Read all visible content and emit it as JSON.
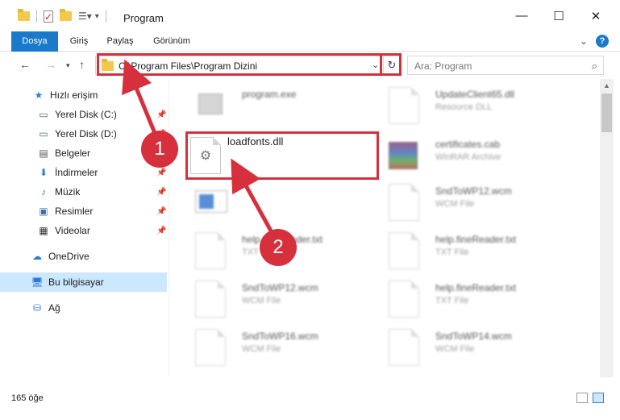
{
  "window": {
    "title": "Program"
  },
  "ribbon": {
    "tabs": [
      "Dosya",
      "Giriş",
      "Paylaş",
      "Görünüm"
    ]
  },
  "address": {
    "path": "C:\\Program Files\\Program Dizini"
  },
  "search": {
    "placeholder": "Ara: Program"
  },
  "sidebar": {
    "items": [
      {
        "label": "Hızlı erişim",
        "icon": "star-icon"
      },
      {
        "label": "Yerel Disk (C:)",
        "icon": "drive-icon",
        "pinned": true
      },
      {
        "label": "Yerel Disk (D:)",
        "icon": "drive-icon",
        "pinned": true
      },
      {
        "label": "Belgeler",
        "icon": "documents-icon",
        "pinned": true
      },
      {
        "label": "İndirmeler",
        "icon": "download-icon",
        "pinned": true
      },
      {
        "label": "Müzik",
        "icon": "music-icon",
        "pinned": true
      },
      {
        "label": "Resimler",
        "icon": "pictures-icon",
        "pinned": true
      },
      {
        "label": "Videolar",
        "icon": "videos-icon",
        "pinned": true
      },
      {
        "label": "OneDrive",
        "icon": "cloud-icon"
      },
      {
        "label": "Bu bilgisayar",
        "icon": "computer-icon",
        "selected": true
      },
      {
        "label": "Ağ",
        "icon": "network-icon"
      }
    ]
  },
  "files": [
    {
      "name": "program.exe",
      "type": "",
      "icon": "exe-icon"
    },
    {
      "name": "UpdateClient65.dll",
      "type": "Resource DLL",
      "icon": "dll-icon"
    },
    {
      "name": "loadfonts.dll",
      "type": "",
      "icon": "dll-gear-icon"
    },
    {
      "name": "certificates.cab",
      "type": "WinRAR Archive",
      "icon": "archive-icon"
    },
    {
      "name": "",
      "type": "",
      "icon": "installer-icon"
    },
    {
      "name": "SndToWP12.wcm",
      "type": "WCM File",
      "icon": "file-icon"
    },
    {
      "name": "help.fineReader.txt",
      "type": "TXT File",
      "icon": "file-icon"
    },
    {
      "name": "help.fineReader.txt",
      "type": "TXT File",
      "icon": "file-icon"
    },
    {
      "name": "SndToWP12.wcm",
      "type": "WCM File",
      "icon": "file-icon"
    },
    {
      "name": "help.fineReader.txt",
      "type": "TXT File",
      "icon": "file-icon"
    },
    {
      "name": "SndToWP16.wcm",
      "type": "WCM File",
      "icon": "file-icon"
    },
    {
      "name": "SndToWP14.wcm",
      "type": "WCM File",
      "icon": "file-icon"
    }
  ],
  "status": {
    "count": "165 öğe"
  },
  "annotations": {
    "step1": "1",
    "step2": "2"
  },
  "colors": {
    "accent": "#1979ca",
    "highlight": "#d6303c",
    "selected": "#cce8ff"
  }
}
